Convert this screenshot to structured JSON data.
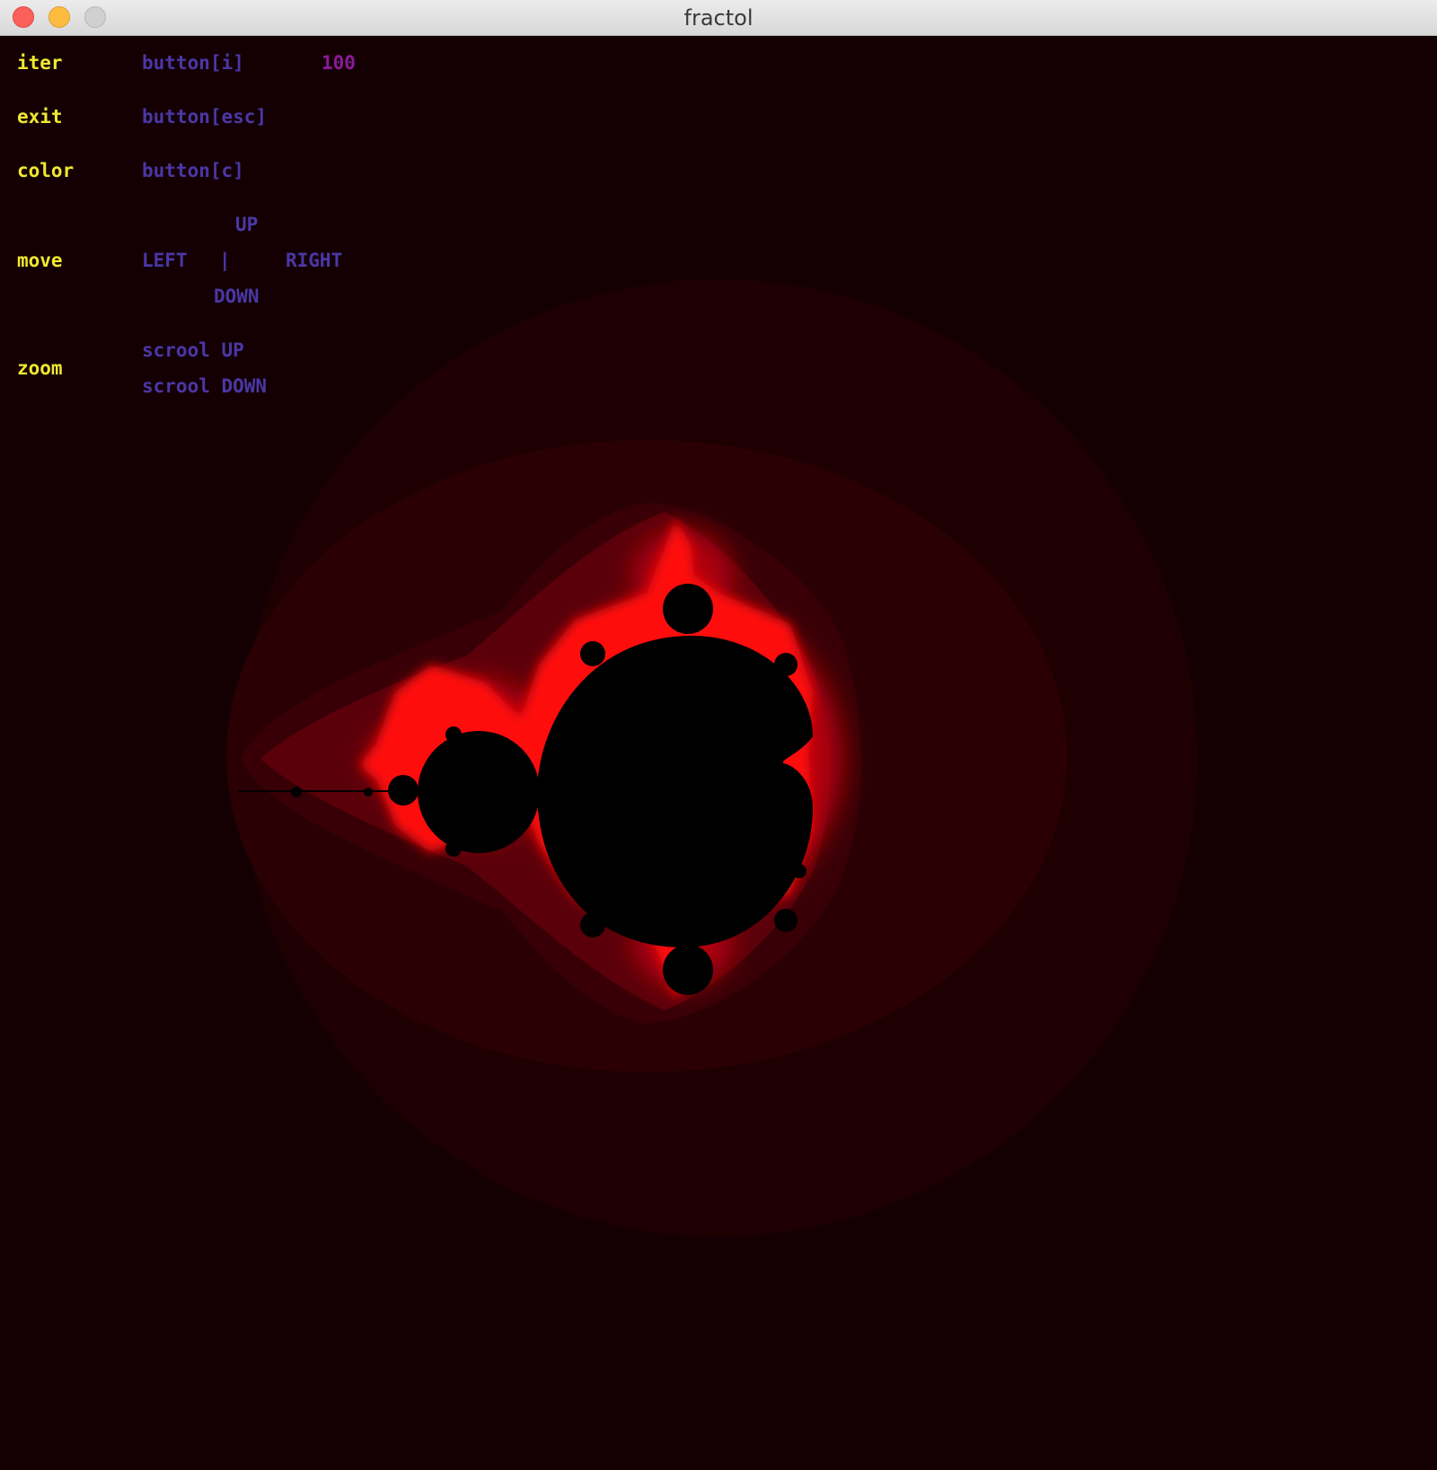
{
  "window": {
    "title": "fractol"
  },
  "colors": {
    "background": "#140002",
    "key_label": "#f0e830",
    "command_label": "#4a37a6",
    "value": "#8a1a9a",
    "fractal_set": "#000000",
    "fractal_edge": "#ff0a0a"
  },
  "hud": {
    "iter": {
      "label": "iter",
      "command": "button[i]",
      "value": "100"
    },
    "exit": {
      "label": "exit",
      "command": "button[esc]"
    },
    "color": {
      "label": "color",
      "command": "button[c]"
    },
    "move": {
      "label": "move",
      "up": "UP",
      "left": "LEFT",
      "separator": "|",
      "right": "RIGHT",
      "down": "DOWN"
    },
    "zoom": {
      "label": "zoom",
      "scroll_up": "scrool UP",
      "scroll_down": "scrool DOWN"
    }
  }
}
